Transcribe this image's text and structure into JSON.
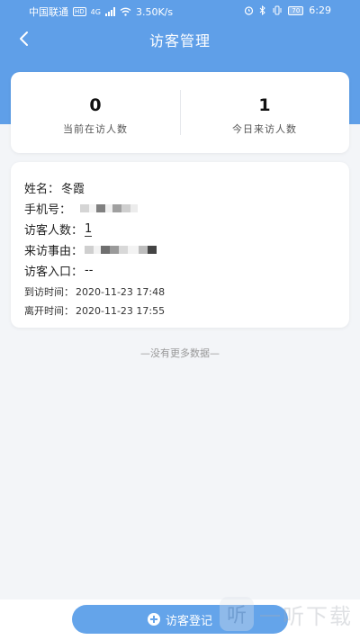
{
  "status_bar": {
    "carrier": "中国联通",
    "hd_badge": "HD",
    "network": "4G",
    "speed": "3.50K/s",
    "battery": "70",
    "time": "6:29"
  },
  "nav": {
    "title": "访客管理"
  },
  "stats": {
    "current_count": "0",
    "current_label": "当前在访人数",
    "today_count": "1",
    "today_label": "今日来访人数"
  },
  "visitor": {
    "name_label": "姓名：",
    "name_value": "冬霞",
    "phone_label": "手机号：",
    "count_label": "访客人数：",
    "count_value": "1",
    "reason_label": "来访事由：",
    "entrance_label": "访客入口：",
    "entrance_value": "--",
    "arrive_label": "到访时间：",
    "arrive_value": "2020-11-23 17:48",
    "leave_label": "离开时间：",
    "leave_value": "2020-11-23 17:55"
  },
  "list_end_text": "—没有更多数据—",
  "register_button_label": "访客登记",
  "colors": {
    "header_blue": "#5f9fe8",
    "button_blue": "#64a4ea",
    "background": "#f3f5f8"
  }
}
